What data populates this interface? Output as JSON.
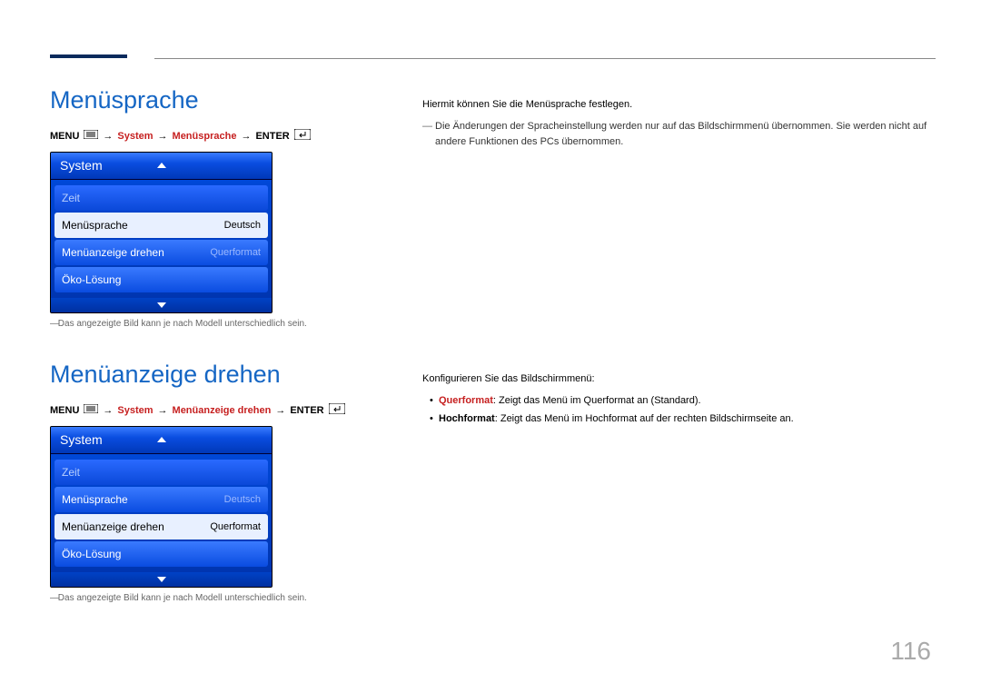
{
  "page_number": "116",
  "section1": {
    "title": "Menüsprache",
    "breadcrumb": {
      "menu": "MENU",
      "system": "System",
      "current": "Menüsprache",
      "enter": "ENTER"
    },
    "menu": {
      "header": "System",
      "items": [
        {
          "label": "Zeit",
          "value": ""
        },
        {
          "label": "Menüsprache",
          "value": "Deutsch"
        },
        {
          "label": "Menüanzeige drehen",
          "value": "Querformat"
        },
        {
          "label": "Öko-Lösung",
          "value": ""
        }
      ]
    },
    "caption": "Das angezeigte Bild kann je nach Modell unterschiedlich sein.",
    "desc_main": "Hiermit können Sie die Menüsprache festlegen.",
    "desc_note": "Die Änderungen der Spracheinstellung werden nur auf das Bildschirmmenü übernommen. Sie werden nicht auf andere Funktionen des PCs übernommen."
  },
  "section2": {
    "title": "Menüanzeige drehen",
    "breadcrumb": {
      "menu": "MENU",
      "system": "System",
      "current": "Menüanzeige drehen",
      "enter": "ENTER"
    },
    "menu": {
      "header": "System",
      "items": [
        {
          "label": "Zeit",
          "value": ""
        },
        {
          "label": "Menüsprache",
          "value": "Deutsch"
        },
        {
          "label": "Menüanzeige drehen",
          "value": "Querformat"
        },
        {
          "label": "Öko-Lösung",
          "value": ""
        }
      ]
    },
    "caption": "Das angezeigte Bild kann je nach Modell unterschiedlich sein.",
    "desc_main": "Konfigurieren Sie das Bildschirmmenü:",
    "bullets": [
      {
        "term": "Querformat",
        "rest": ": Zeigt das Menü im Querformat an (Standard)."
      },
      {
        "term": "Hochformat",
        "rest": ": Zeigt das Menü im Hochformat auf der rechten Bildschirmseite an."
      }
    ]
  }
}
